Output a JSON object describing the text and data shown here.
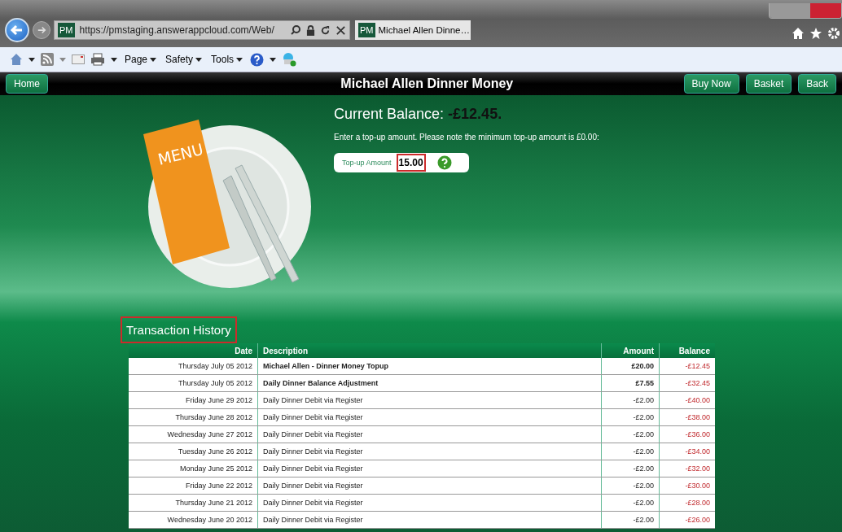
{
  "browser": {
    "address": "https://pmstaging.answerappcloud.com/Web/",
    "tab_title": "Michael Allen Dinne…",
    "tab_favicon": "PM",
    "address_favicon": "PM",
    "menus": [
      "Page",
      "Safety",
      "Tools"
    ]
  },
  "header": {
    "title": "Michael Allen Dinner Money",
    "left_buttons": [
      "Home"
    ],
    "right_buttons": [
      "Buy Now",
      "Basket",
      "Back"
    ]
  },
  "illustration": {
    "card_text": "MENU"
  },
  "balance": {
    "label": "Current Balance:",
    "value": "-£12.45."
  },
  "note": "Enter a top-up amount. Please note the minimum top-up amount is £0.00:",
  "topup": {
    "label": "Top-up Amount",
    "value": "15.00",
    "highlighted": true
  },
  "history": {
    "title": "Transaction History",
    "highlighted": true,
    "columns": [
      "Date",
      "Description",
      "Amount",
      "Balance"
    ],
    "rows": [
      {
        "date": "Thursday July 05 2012",
        "description": "Michael Allen - Dinner Money Topup",
        "amount": "£20.00",
        "balance": "-£12.45",
        "bold": true
      },
      {
        "date": "Thursday July 05 2012",
        "description": "Daily Dinner Balance Adjustment",
        "amount": "£7.55",
        "balance": "-£32.45",
        "bold": true
      },
      {
        "date": "Friday June 29 2012",
        "description": "Daily Dinner Debit via Register",
        "amount": "-£2.00",
        "balance": "-£40.00",
        "bold": false
      },
      {
        "date": "Thursday June 28 2012",
        "description": "Daily Dinner Debit via Register",
        "amount": "-£2.00",
        "balance": "-£38.00",
        "bold": false
      },
      {
        "date": "Wednesday June 27 2012",
        "description": "Daily Dinner Debit via Register",
        "amount": "-£2.00",
        "balance": "-£36.00",
        "bold": false
      },
      {
        "date": "Tuesday June 26 2012",
        "description": "Daily Dinner Debit via Register",
        "amount": "-£2.00",
        "balance": "-£34.00",
        "bold": false
      },
      {
        "date": "Monday June 25 2012",
        "description": "Daily Dinner Debit via Register",
        "amount": "-£2.00",
        "balance": "-£32.00",
        "bold": false
      },
      {
        "date": "Friday June 22 2012",
        "description": "Daily Dinner Debit via Register",
        "amount": "-£2.00",
        "balance": "-£30.00",
        "bold": false
      },
      {
        "date": "Thursday June 21 2012",
        "description": "Daily Dinner Debit via Register",
        "amount": "-£2.00",
        "balance": "-£28.00",
        "bold": false
      },
      {
        "date": "Wednesday June 20 2012",
        "description": "Daily Dinner Debit via Register",
        "amount": "-£2.00",
        "balance": "-£26.00",
        "bold": false
      }
    ]
  }
}
